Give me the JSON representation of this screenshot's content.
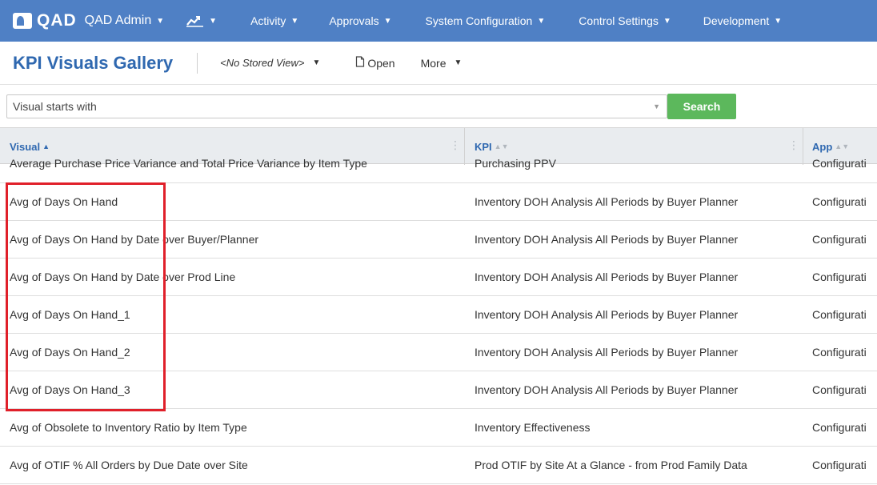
{
  "nav": {
    "logo_text": "QAD",
    "user_menu": "QAD Admin",
    "items": [
      {
        "label": "Activity"
      },
      {
        "label": "Approvals"
      },
      {
        "label": "System Configuration"
      },
      {
        "label": "Control Settings"
      },
      {
        "label": "Development"
      }
    ],
    "bg_color": "#4f80c5"
  },
  "header": {
    "title": "KPI Visuals Gallery",
    "stored_view": "<No Stored View>",
    "open_label": "Open",
    "more_label": "More"
  },
  "search": {
    "placeholder": "Visual starts with",
    "button_label": "Search",
    "button_color": "#5cb85c"
  },
  "grid": {
    "columns": [
      {
        "label": "Visual",
        "sort": "ascending"
      },
      {
        "label": "KPI",
        "sort": "none"
      },
      {
        "label": "App",
        "sort": "none"
      }
    ],
    "rows": [
      {
        "visual": "Average Purchase Price Variance and Total Price Variance by Item Type",
        "kpi": "Purchasing PPV",
        "app": "Configurati"
      },
      {
        "visual": "Avg of Days On Hand",
        "kpi": "Inventory DOH Analysis All Periods by Buyer Planner",
        "app": "Configurati"
      },
      {
        "visual": "Avg of Days On Hand by Date over Buyer/Planner",
        "kpi": "Inventory DOH Analysis All Periods by Buyer Planner",
        "app": "Configurati"
      },
      {
        "visual": "Avg of Days On Hand by Date over Prod Line",
        "kpi": "Inventory DOH Analysis All Periods by Buyer Planner",
        "app": "Configurati"
      },
      {
        "visual": "Avg of Days On Hand_1",
        "kpi": "Inventory DOH Analysis All Periods by Buyer Planner",
        "app": "Configurati"
      },
      {
        "visual": "Avg of Days On Hand_2",
        "kpi": "Inventory DOH Analysis All Periods by Buyer Planner",
        "app": "Configurati"
      },
      {
        "visual": "Avg of Days On Hand_3",
        "kpi": "Inventory DOH Analysis All Periods by Buyer Planner",
        "app": "Configurati"
      },
      {
        "visual": "Avg of Obsolete to Inventory Ratio by Item Type",
        "kpi": "Inventory Effectiveness",
        "app": "Configurati"
      },
      {
        "visual": "Avg of OTIF % All Orders by Due Date over Site",
        "kpi": "Prod OTIF by Site At a Glance - from Prod Family Data",
        "app": "Configurati"
      }
    ]
  },
  "highlight_color": "#e0202a"
}
